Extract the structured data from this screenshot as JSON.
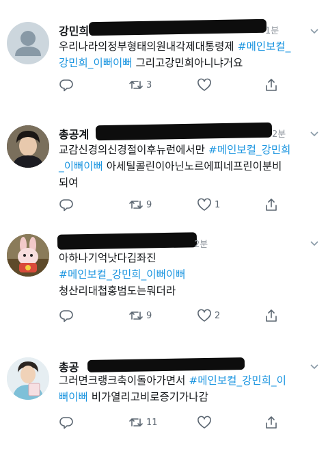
{
  "tweets": [
    {
      "name": "강민희",
      "time": "1분",
      "lines": [
        [
          {
            "t": "우리나라의정부형태의원내각제대통령제 ",
            "tag": false
          },
          {
            "t": "#메인보컬_",
            "tag": true
          }
        ],
        [
          {
            "t": "강민희_이뻐이뻐",
            "tag": true
          },
          {
            "t": " 그리고강민희아니냐거요",
            "tag": false
          }
        ]
      ],
      "retweets": "3",
      "likes": ""
    },
    {
      "name": "총공계",
      "time": "2분",
      "lines": [
        [
          {
            "t": "교감신경의신경절이후뉴런에서만 ",
            "tag": false
          },
          {
            "t": "#메인보컬_강민희",
            "tag": true
          }
        ],
        [
          {
            "t": "_이뻐이뻐",
            "tag": true
          },
          {
            "t": " 아세틸콜린이아닌노르에피네프린이분비",
            "tag": false
          }
        ],
        [
          {
            "t": "되여",
            "tag": false
          }
        ]
      ],
      "retweets": "9",
      "likes": "1"
    },
    {
      "name": "",
      "time": "2분",
      "lines": [
        [
          {
            "t": "아하나기억낫다김좌진",
            "tag": false
          }
        ],
        [
          {
            "t": "#메인보컬_강민희_이뻐이뻐",
            "tag": true
          }
        ],
        [
          {
            "t": "청산리대첩홍범도는뭐더라",
            "tag": false
          }
        ]
      ],
      "retweets": "9",
      "likes": "2"
    },
    {
      "name": "총공",
      "time": "",
      "lines": [
        [
          {
            "t": "그러면크랭크축이돌아가면서 ",
            "tag": false
          },
          {
            "t": "#메인보컬_강민희_이",
            "tag": true
          }
        ],
        [
          {
            "t": "뻐이뻐",
            "tag": true
          },
          {
            "t": " 비가열리고비로증기가나감",
            "tag": false
          }
        ]
      ],
      "retweets": "11",
      "likes": ""
    }
  ],
  "colors": {
    "hashtag": "#1b95e0",
    "icon": "#5b6671",
    "text": "#14171a"
  },
  "icons": {
    "reply": "reply-icon",
    "retweet": "retweet-icon",
    "like": "heart-icon",
    "share": "share-icon",
    "more": "chevron-down-icon"
  }
}
